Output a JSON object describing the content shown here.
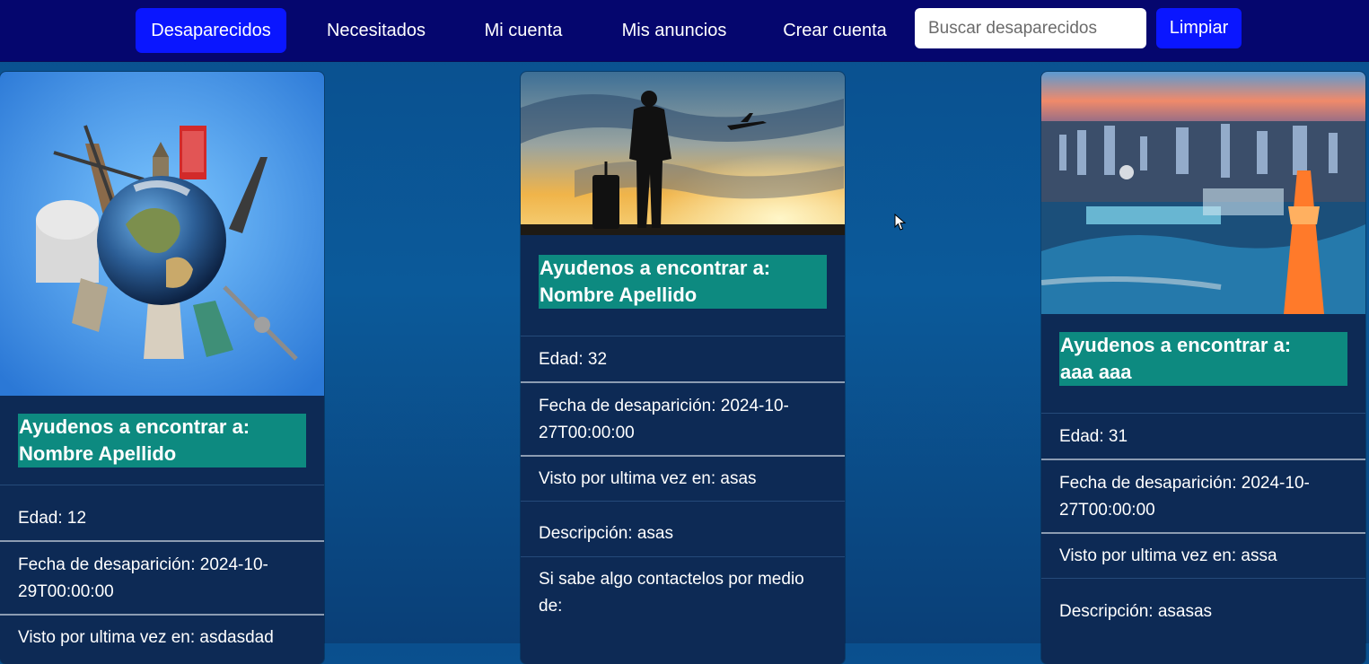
{
  "nav": {
    "items": [
      {
        "label": "Desaparecidos",
        "active": true
      },
      {
        "label": "Necesitados",
        "active": false
      },
      {
        "label": "Mi cuenta",
        "active": false
      },
      {
        "label": "Mis anuncios",
        "active": false
      },
      {
        "label": "Crear cuenta",
        "active": false
      }
    ],
    "search_placeholder": "Buscar desaparecidos",
    "clear_label": "Limpiar"
  },
  "cards": [
    {
      "image": "world-landmarks-image",
      "title_line1": "Ayudenos a encontrar a:",
      "title_line2": "Nombre Apellido",
      "age": "Edad: 12",
      "date_line1": "Fecha de desaparición: 2024-10-",
      "date_line2": "29T00:00:00",
      "last_seen": "Visto por ultima vez en: asdasdad"
    },
    {
      "image": "traveler-sunset-image",
      "title_line1": "Ayudenos a encontrar a:",
      "title_line2": "Nombre Apellido",
      "age": "Edad: 32",
      "date_line1": "Fecha de desaparición: 2024-10-",
      "date_line2": "27T00:00:00",
      "last_seen": "Visto por ultima vez en: asas",
      "description": "Descripción: asas",
      "contact_line1": "Si sabe algo contactelos por medio",
      "contact_line2": "de:"
    },
    {
      "image": "city-night-image",
      "title_line1": "Ayudenos a encontrar a:",
      "title_line2": "aaa aaa",
      "age": "Edad: 31",
      "date_line1": "Fecha de desaparición: 2024-10-",
      "date_line2": "27T00:00:00",
      "last_seen": "Visto por ultima vez en: assa",
      "description": "Descripción: asasas"
    }
  ],
  "colors": {
    "navbar": "#05066e",
    "active": "#0a16ff",
    "card": "#0d2a55",
    "title_bg": "#0d8a80"
  }
}
